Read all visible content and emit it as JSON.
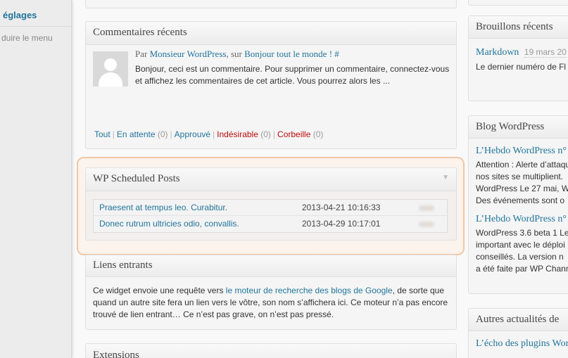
{
  "sidebar": {
    "active_item": "églages",
    "collapse_label": "duire le menu"
  },
  "comments_widget": {
    "title": "Commentaires récents",
    "by": "Par",
    "author": "Monsieur WordPress",
    "sur": ", sur",
    "post": "Bonjour tout le monde ! #",
    "excerpt": "Bonjour, ceci est un commentaire. Pour supprimer un commentaire, connectez-vous et affichez les commentaires de cet article. Vous pourrez alors les ...",
    "filters": {
      "all": "Tout",
      "pending": "En attente",
      "pending_count": "(0)",
      "approved": "Approuvé",
      "spam": "Indésirable",
      "spam_count": "(0)",
      "trash": "Corbeille",
      "trash_count": "(0)"
    }
  },
  "scheduled_widget": {
    "title": "WP Scheduled Posts",
    "toggle_icon": "triangle-down",
    "posts": [
      {
        "title": "Praesent at tempus leo. Curabitur.",
        "date": "2013-04-21 10:16:33"
      },
      {
        "title": "Donec rutrum ultricies odio, convallis.",
        "date": "2013-04-29 10:17:01"
      }
    ]
  },
  "incoming_links_widget": {
    "title": "Liens entrants",
    "text_before": "Ce widget envoie une requête vers ",
    "link": "le moteur de recherche des blogs de Google",
    "text_after": ", de sorte que quand un autre site fera un lien vers le vôtre, son nom s’affichera ici. Ce moteur n’a pas encore trouvé de lien entrant… Ce n’est pas grave, on n’est pas pressé."
  },
  "extensions_widget": {
    "title": "Extensions"
  },
  "drafts_widget": {
    "title": "Brouillons récents",
    "item_title": "Markdown",
    "item_date": "19 mars 20",
    "item_text": "Le dernier numéro de Fl"
  },
  "blog_widget": {
    "title": "Blog WordPress",
    "items": [
      {
        "title": "L’Hebdo WordPress n°",
        "lines": [
          "Attention : Alerte d’attaqu",
          "nos sites se multiplient.",
          "WordPress Le 27 mai, W",
          "Des événements sont o"
        ]
      },
      {
        "title": "L’Hebdo WordPress n°",
        "lines": [
          "WordPress 3.6 beta 1 Le",
          "important avec le déploi",
          "conseillés. La version n",
          "a été faite par WP Chann"
        ]
      }
    ]
  },
  "other_news_widget": {
    "title": "Autres actualités de",
    "item_title": "L’écho des plugins Wor"
  },
  "colors": {
    "link": "#21759b",
    "spam_red": "#bc0b0b",
    "highlight_border": "#f0c8a5"
  }
}
